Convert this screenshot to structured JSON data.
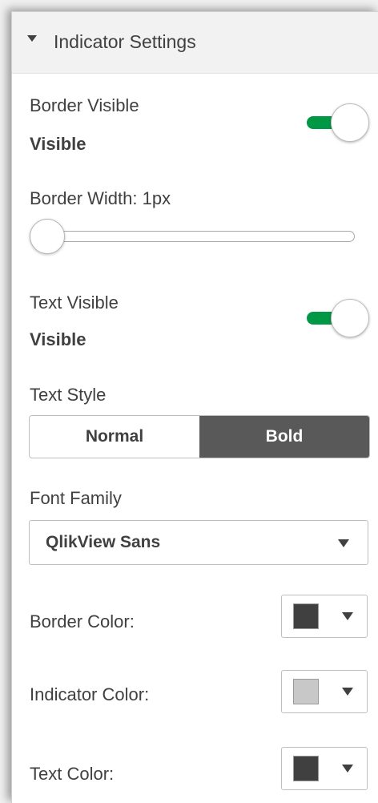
{
  "section": {
    "title": "Indicator Settings"
  },
  "border_visible": {
    "label": "Border Visible",
    "value": "Visible",
    "on": true
  },
  "border_width": {
    "label": "Border Width: 1px",
    "slider_fraction": 0.0
  },
  "text_visible": {
    "label": "Text Visible",
    "value": "Visible",
    "on": true
  },
  "text_style": {
    "label": "Text Style",
    "options": [
      "Normal",
      "Bold"
    ],
    "selected": "Bold"
  },
  "font_family": {
    "label": "Font Family",
    "value": "QlikView Sans"
  },
  "border_color": {
    "label": "Border Color:",
    "color": "#404040"
  },
  "indicator_color": {
    "label": "Indicator Color:",
    "color": "#c8c8c8"
  },
  "text_color": {
    "label": "Text Color:",
    "color": "#404040"
  },
  "theme": {
    "toggle_on": "#009845",
    "segment_active": "#595959"
  }
}
